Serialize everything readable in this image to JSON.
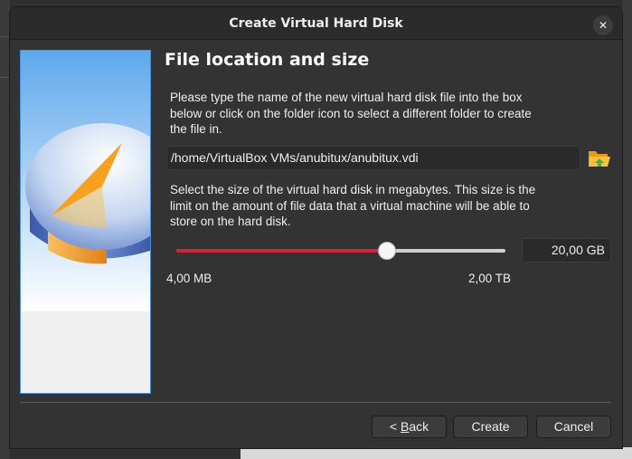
{
  "window": {
    "title": "Create Virtual Hard Disk",
    "close_symbol": "✕"
  },
  "page": {
    "heading": "File location and size",
    "location_description": "Please type the name of the new virtual hard disk file into the box\nbelow or click on the folder icon to select a different folder to create\nthe file in.",
    "file_path": "/home/VirtualBox VMs/anubitux/anubitux.vdi",
    "size_description": "Select the size of the virtual hard disk in megabytes. This size is the\nlimit on the amount of file data that a virtual machine will be able to\nstore on the hard disk.",
    "size_value": "20,00 GB",
    "size_slider_fraction": 0.64,
    "size_min_label": "4,00 MB",
    "size_max_label": "2,00 TB"
  },
  "buttons": {
    "back_prefix": "< ",
    "back_mnemonic": "B",
    "back_rest": "ack",
    "create": "Create",
    "cancel": "Cancel"
  },
  "icons": {
    "close": "close-icon",
    "folder": "folder-open-icon",
    "wizard_art": "disk-pie-illustration"
  },
  "colors": {
    "slider_fill": "#c7283e",
    "accent_border": "#4a90d9",
    "folder": "#f2b01e"
  }
}
